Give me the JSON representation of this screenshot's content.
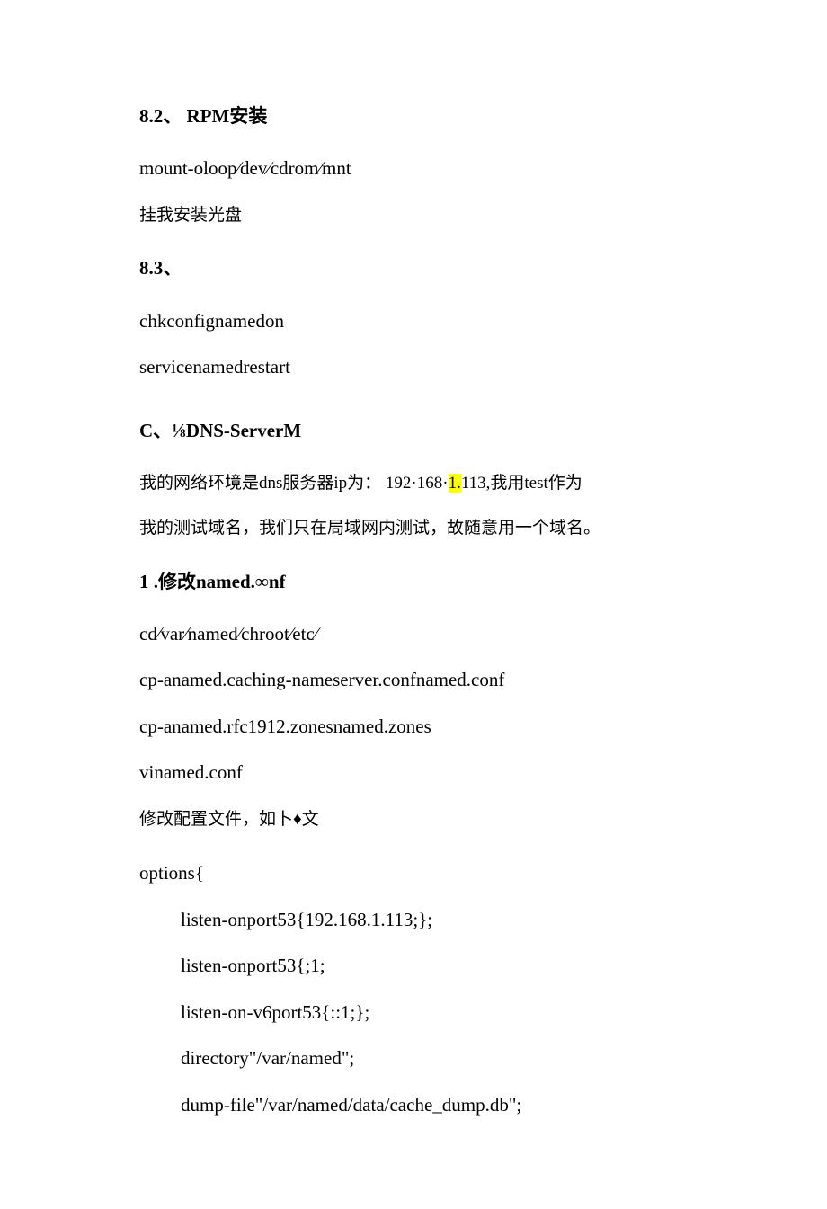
{
  "s82": {
    "heading": "8.2、 RPM安装",
    "cmd": "mount-oloop∕dev∕cdrom∕mnt",
    "note": "挂我安装光盘"
  },
  "s83": {
    "heading": "8.3、",
    "line1": "chkconfignamedon",
    "line2": "servicenamedrestart"
  },
  "sC": {
    "heading": "C、⅛DNS-ServerM",
    "intro1_pre": "我的网络环境是dns服务器ip为： 192·168·",
    "intro1_hl": "1.",
    "intro1_post": "113,我用test作为",
    "intro2": "我的测试域名，我们只在局域网内测试，故随意用一个域名。"
  },
  "s1": {
    "heading": "1 .修改named.∞nf",
    "lines": [
      "cd∕var∕named∕chroot∕etc∕",
      "cp-anamed.caching-nameserver.confnamed.conf",
      "cp-anamed.rfc1912.zonesnamed.zones",
      "vinamed.conf"
    ],
    "note": "修改配置文件，如卜♦文",
    "options_open": "options{",
    "options": [
      "listen-onport53{192.168.1.113;};",
      "listen-onport53{;1;",
      "listen-on-v6port53{::1;};",
      "directory\"/var/named\";",
      "dump-file\"/var/named/data/cache_dump.db\";"
    ]
  }
}
